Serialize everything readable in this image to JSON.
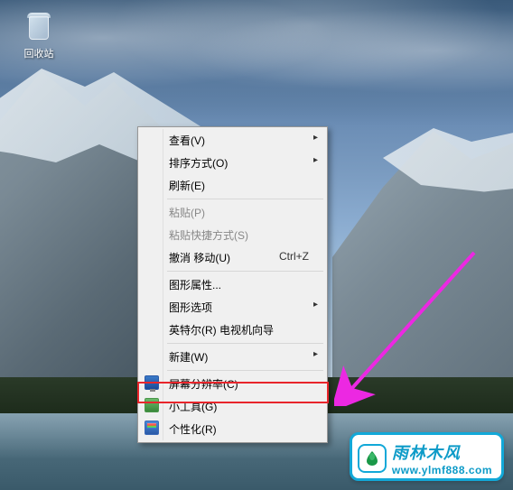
{
  "desktop": {
    "recycle_bin_label": "回收站"
  },
  "context_menu": {
    "view": {
      "label": "查看(V)"
    },
    "sort": {
      "label": "排序方式(O)"
    },
    "refresh": {
      "label": "刷新(E)"
    },
    "paste": {
      "label": "粘贴(P)"
    },
    "paste_shortcut": {
      "label": "粘贴快捷方式(S)"
    },
    "undo_move": {
      "label": "撤消 移动(U)",
      "shortcut": "Ctrl+Z"
    },
    "graphics_props": {
      "label": "图形属性..."
    },
    "graphics_options": {
      "label": "图形选项"
    },
    "intel_tv": {
      "label": "英特尔(R) 电视机向导"
    },
    "new": {
      "label": "新建(W)"
    },
    "screen_res": {
      "label": "屏幕分辨率(C)"
    },
    "gadgets": {
      "label": "小工具(G)"
    },
    "personalize": {
      "label": "个性化(R)"
    }
  },
  "watermark": {
    "brand": "雨林木风",
    "url": "www.ylmf888.com"
  },
  "annotation": {
    "arrow_color": "#ec28e2",
    "highlight_color": "#e8252b"
  }
}
